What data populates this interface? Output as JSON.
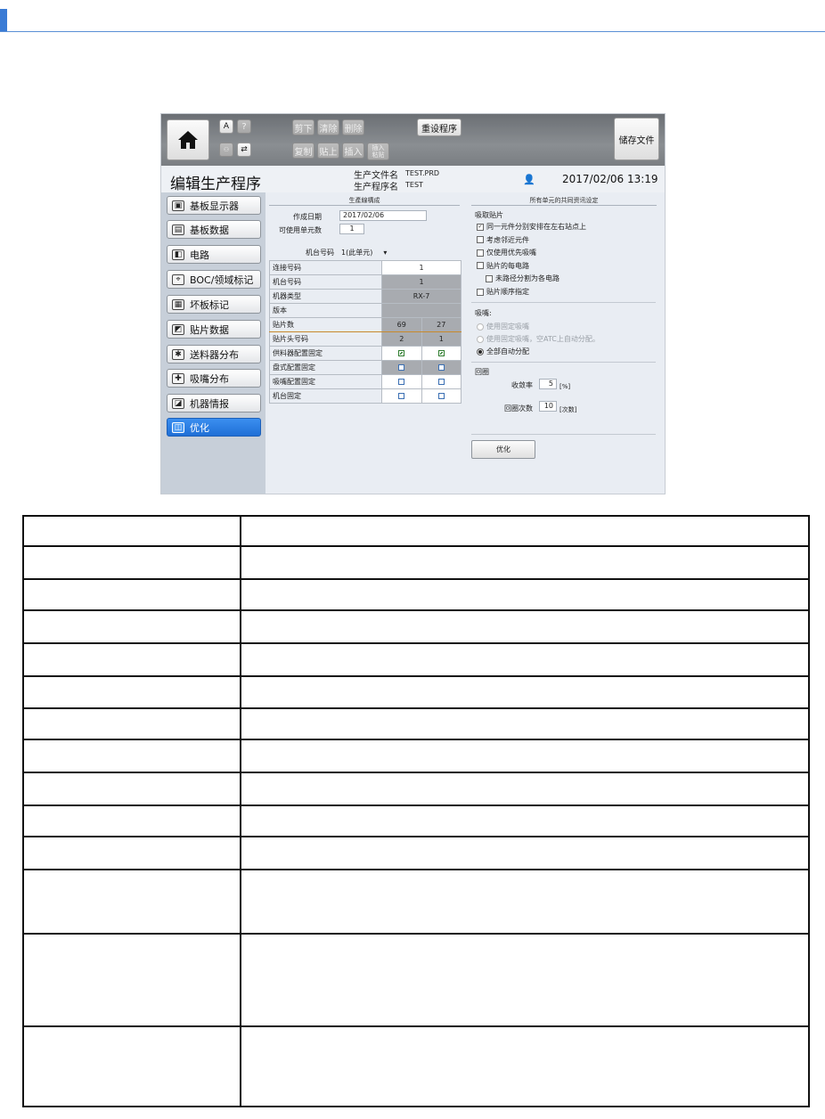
{
  "toolbar": {
    "edit_buttons": [
      "剪下",
      "清除",
      "删除",
      "复制",
      "贴上",
      "插入",
      "插入\n粘贴"
    ],
    "reset_label": "重设程序",
    "save_label": "储存文件"
  },
  "titlebar": {
    "title": "编辑生产程序",
    "file_label": "生产文件名",
    "file_value": "TEST.PRD",
    "program_label": "生产程序名",
    "program_value": "TEST",
    "datetime": "2017/02/06 13:19"
  },
  "sidebar": {
    "items": [
      {
        "label": "基板显示器",
        "icon": "board-display-icon",
        "glyph": "▣"
      },
      {
        "label": "基板数据",
        "icon": "board-data-icon",
        "glyph": "▤"
      },
      {
        "label": "电路",
        "icon": "circuit-icon",
        "glyph": "◧"
      },
      {
        "label": "BOC/领域标记",
        "icon": "boc-mark-icon",
        "glyph": "⌖"
      },
      {
        "label": "坏板标记",
        "icon": "bad-board-icon",
        "glyph": "▦"
      },
      {
        "label": "贴片数据",
        "icon": "placement-data-icon",
        "glyph": "◩"
      },
      {
        "label": "送料器分布",
        "icon": "feeder-icon",
        "glyph": "✱"
      },
      {
        "label": "吸嘴分布",
        "icon": "nozzle-icon",
        "glyph": "✚"
      },
      {
        "label": "机器情报",
        "icon": "machine-info-icon",
        "glyph": "◪"
      },
      {
        "label": "优化",
        "icon": "optimize-icon",
        "glyph": "◫"
      }
    ]
  },
  "left_panel": {
    "heading": "生產線構成",
    "created_label": "作成日期",
    "created_value": "2017/02/06",
    "units_label": "可使用单元数",
    "units_value": "1",
    "machine_no_label": "机台号码",
    "machine_no_value": "1(此单元)",
    "grid": [
      {
        "label": "连接号码",
        "a": "1",
        "b": "",
        "span": true,
        "style": "w"
      },
      {
        "label": "机台号码",
        "a": "1",
        "b": "",
        "span": true,
        "style": "g"
      },
      {
        "label": "机器类型",
        "a": "RX-7",
        "b": "",
        "span": true,
        "style": "g"
      },
      {
        "label": "版本",
        "a": "",
        "b": "",
        "span": true,
        "style": "g"
      },
      {
        "label": "贴片数",
        "a": "69",
        "b": "27",
        "span": false,
        "style": "g"
      },
      {
        "label": "贴片头号码",
        "a": "2",
        "b": "1",
        "span": false,
        "style": "g"
      },
      {
        "label": "供料器配置固定",
        "a": "☑",
        "b": "☑",
        "span": false,
        "style": "w"
      },
      {
        "label": "盘式配置固定",
        "a": "☐",
        "b": "☐",
        "span": false,
        "style": "g"
      },
      {
        "label": "吸嘴配置固定",
        "a": "☐",
        "b": "☐",
        "span": false,
        "style": "w"
      },
      {
        "label": "机台固定",
        "a": "☐",
        "b": "☐",
        "span": false,
        "style": "w"
      }
    ]
  },
  "right_panel": {
    "heading": "所有单元的共同资讯设定",
    "pickup_heading": "吸取贴片",
    "pickup_opts": [
      {
        "label": "同一元件分别安排在左右站点上",
        "checked": true
      },
      {
        "label": "考虑邻近元件",
        "checked": false
      },
      {
        "label": "仅使用优先吸嘴",
        "checked": false
      },
      {
        "label": "贴片的每电路",
        "checked": false
      },
      {
        "label": "未路径分割为各电路",
        "checked": false
      },
      {
        "label": "贴片顺序指定",
        "checked": false
      }
    ],
    "nozzle_heading": "吸嘴:",
    "nozzle_opts": [
      {
        "label": "使用固定吸嘴",
        "selected": false,
        "dim": true
      },
      {
        "label": "使用固定吸嘴，空ATC上自动分配。",
        "selected": false,
        "dim": true
      },
      {
        "label": "全部自动分配",
        "selected": true,
        "dim": false
      }
    ],
    "loop_heading": "回圈",
    "convergence_label": "收敛率",
    "convergence_value": "5",
    "convergence_unit": "[%]",
    "loops_label": "回圈次数",
    "loops_value": "10",
    "loops_unit": "[次数]",
    "optimize_button": "优化"
  },
  "desc_table": {
    "rows": [
      {
        "key": "",
        "value": "",
        "height": 34
      },
      {
        "key": "",
        "value": "",
        "height": 37
      },
      {
        "key": "",
        "value": "",
        "height": 35
      },
      {
        "key": "",
        "value": "",
        "height": 37
      },
      {
        "key": "",
        "value": "",
        "height": 37
      },
      {
        "key": "",
        "value": "",
        "height": 36
      },
      {
        "key": "",
        "value": "",
        "height": 35
      },
      {
        "key": "",
        "value": "",
        "height": 37
      },
      {
        "key": "",
        "value": "",
        "height": 37
      },
      {
        "key": "",
        "value": "",
        "height": 35
      },
      {
        "key": "",
        "value": "",
        "height": 37
      },
      {
        "key": "",
        "value": "",
        "height": 72
      },
      {
        "key": "",
        "value": "",
        "height": 104
      },
      {
        "key": "",
        "value": "",
        "height": 90
      }
    ]
  }
}
